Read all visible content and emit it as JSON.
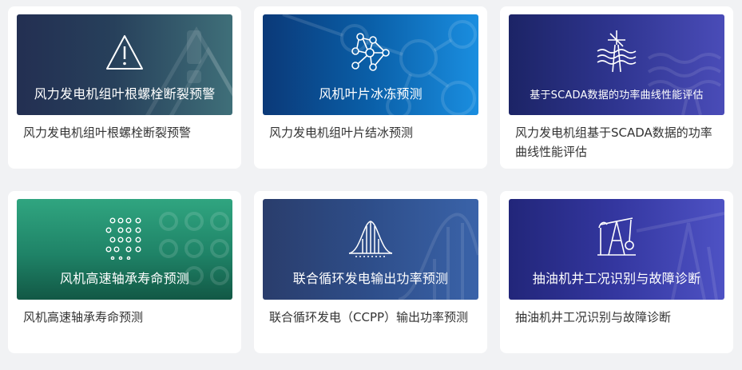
{
  "cards": [
    {
      "banner_title": "风力发电机组叶根螺栓断裂预警",
      "description": "风力发电机组叶根螺栓断裂预警",
      "icon": "warning-icon"
    },
    {
      "banner_title": "风机叶片冰冻预测",
      "description": "风力发电机组叶片结冰预测",
      "icon": "network-icon"
    },
    {
      "banner_title": "基于SCADA数据的功率曲线性能评估",
      "description": "风力发电机组基于SCADA数据的功率曲线性能评估",
      "icon": "wind-turbine-icon"
    },
    {
      "banner_title": "风机高速轴承寿命预测",
      "description": "风机高速轴承寿命预测",
      "icon": "dot-grid-icon"
    },
    {
      "banner_title": "联合循环发电输出功率预测",
      "description": "联合循环发电（CCPP）输出功率预测",
      "icon": "distribution-curve-icon"
    },
    {
      "banner_title": "抽油机井工况识别与故障诊断",
      "description": "抽油机井工况识别与故障诊断",
      "icon": "pump-jack-icon"
    }
  ]
}
